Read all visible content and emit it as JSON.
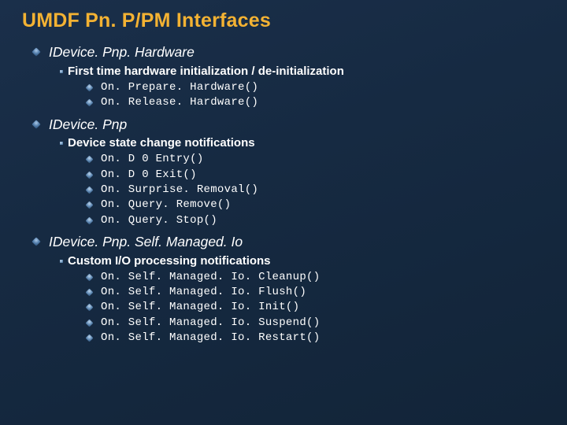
{
  "title": "UMDF Pn. P/PM Interfaces",
  "sections": [
    {
      "heading": "IDevice. Pnp. Hardware",
      "sub": "First time hardware initialization / de-initialization",
      "items": [
        "On. Prepare. Hardware()",
        "On. Release. Hardware()"
      ]
    },
    {
      "heading": "IDevice. Pnp",
      "sub": "Device state change notifications",
      "items": [
        "On. D 0 Entry()",
        "On. D 0 Exit()",
        "On. Surprise. Removal()",
        "On. Query. Remove()",
        "On. Query. Stop()"
      ]
    },
    {
      "heading": "IDevice. Pnp. Self. Managed. Io",
      "sub": "Custom I/O processing notifications",
      "items": [
        "On. Self. Managed. Io. Cleanup()",
        "On. Self. Managed. Io. Flush()",
        "On. Self. Managed. Io. Init()",
        "On. Self. Managed. Io. Suspend()",
        "On. Self. Managed. Io. Restart()"
      ]
    }
  ]
}
